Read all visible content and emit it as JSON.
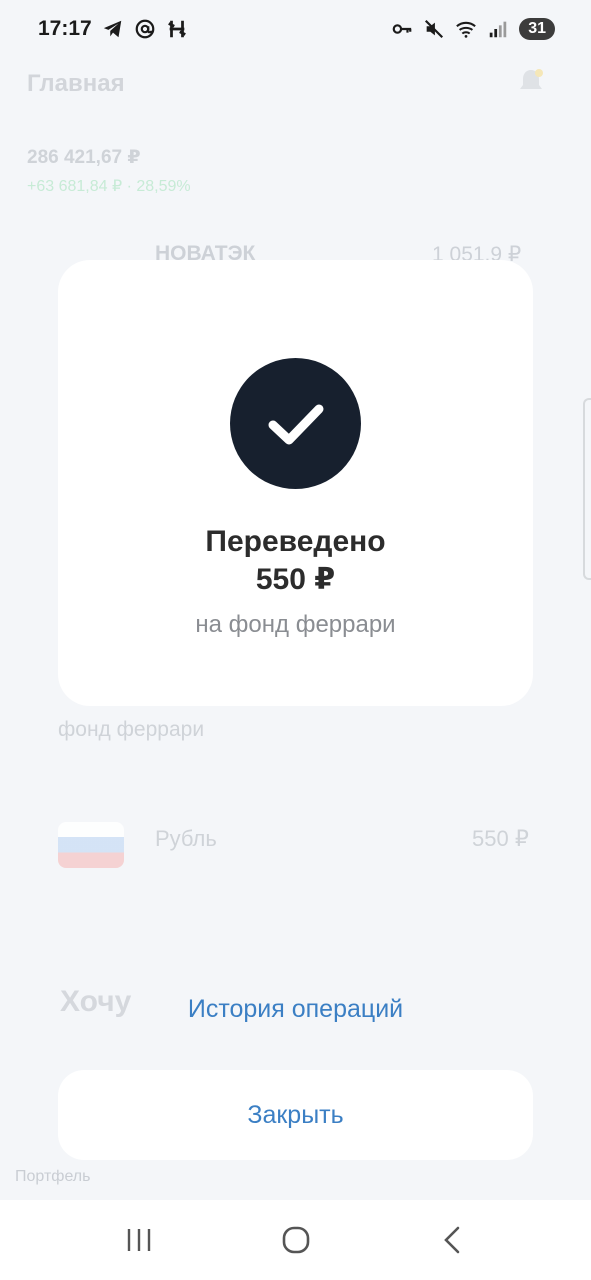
{
  "status_bar": {
    "time": "17:17",
    "battery": "31",
    "icons": [
      "telegram-icon",
      "at-icon",
      "app-h-icon",
      "key-icon",
      "mute-icon",
      "wifi-icon",
      "signal-icon"
    ]
  },
  "background": {
    "title": "Главная",
    "balance": "286 421,67 ₽",
    "change": "+63 681,84 ₽ · 28,59%",
    "stock_name": "НОВАТЭК",
    "stock_value": "1 051,9 ₽",
    "fund_name": "фонд феррари",
    "rub_label": "Рубль",
    "rub_value": "550 ₽",
    "want_label": "Хочу",
    "portfolio_label": "Портфель"
  },
  "success": {
    "title": "Переведено",
    "amount": "550 ₽",
    "subtitle": "на фонд феррари"
  },
  "actions": {
    "history_label": "История операций",
    "close_label": "Закрыть"
  },
  "colors": {
    "accent": "#3b7fc4",
    "check_bg": "#17202e",
    "card_bg": "#ffffff"
  }
}
